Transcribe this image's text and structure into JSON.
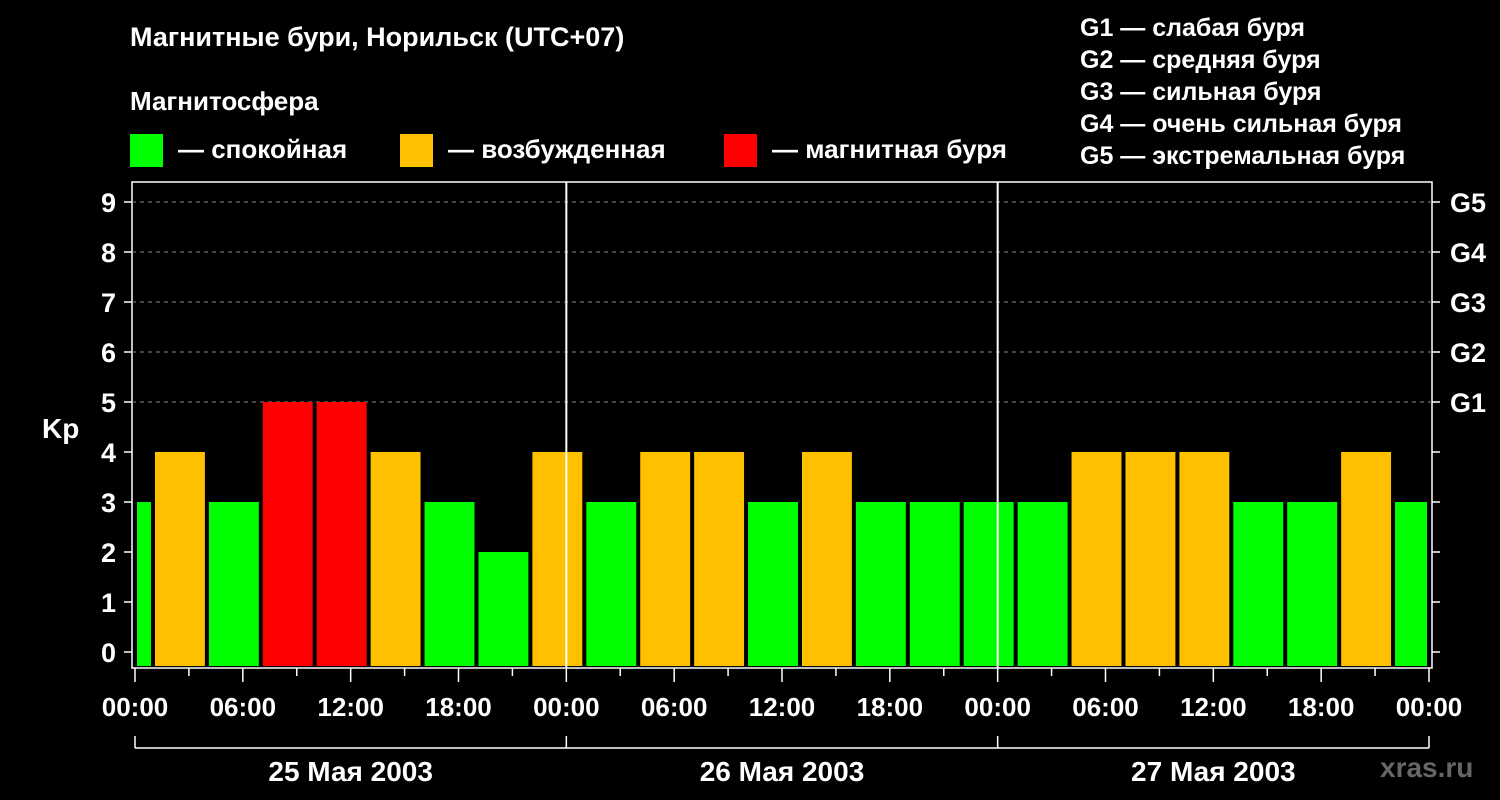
{
  "title": "Магнитные бури, Норильск (UTC+07)",
  "legend": {
    "title": "Магнитосфера",
    "items": [
      {
        "label": "— спокойная",
        "color": "#00ff00"
      },
      {
        "label": "— возбужденная",
        "color": "#ffc000"
      },
      {
        "label": "— магнитная буря",
        "color": "#ff0000"
      }
    ]
  },
  "g_scale": [
    "G1 — слабая буря",
    "G2 — средняя буря",
    "G3 — сильная буря",
    "G4 — очень сильная буря",
    "G5 — экстремальная буря"
  ],
  "watermark": "xras.ru",
  "chart_data": {
    "type": "bar",
    "ylabel": "Kp",
    "ylim": [
      0,
      9
    ],
    "yticks": [
      "0",
      "1",
      "2",
      "3",
      "4",
      "5",
      "6",
      "7",
      "8",
      "9"
    ],
    "right_ticks": [
      {
        "value": 5,
        "label": "G1"
      },
      {
        "value": 6,
        "label": "G2"
      },
      {
        "value": 7,
        "label": "G3"
      },
      {
        "value": 8,
        "label": "G4"
      },
      {
        "value": 9,
        "label": "G5"
      }
    ],
    "xticks": [
      "00:00",
      "06:00",
      "12:00",
      "18:00",
      "00:00",
      "06:00",
      "12:00",
      "18:00",
      "00:00",
      "06:00",
      "12:00",
      "18:00",
      "00:00"
    ],
    "days": [
      "25 Мая 2003",
      "26 Мая 2003",
      "27 Мая 2003"
    ],
    "grid": "dashed at Kp 5–9",
    "colors": {
      "quiet": "#00ff00",
      "active": "#ffc000",
      "storm": "#ff0000"
    },
    "bars": [
      {
        "start_hour": 0,
        "end_hour": 1,
        "value": 3,
        "level": "quiet"
      },
      {
        "start_hour": 1,
        "end_hour": 4,
        "value": 4,
        "level": "active"
      },
      {
        "start_hour": 4,
        "end_hour": 7,
        "value": 3,
        "level": "quiet"
      },
      {
        "start_hour": 7,
        "end_hour": 10,
        "value": 5,
        "level": "storm"
      },
      {
        "start_hour": 10,
        "end_hour": 13,
        "value": 5,
        "level": "storm"
      },
      {
        "start_hour": 13,
        "end_hour": 16,
        "value": 4,
        "level": "active"
      },
      {
        "start_hour": 16,
        "end_hour": 19,
        "value": 3,
        "level": "quiet"
      },
      {
        "start_hour": 19,
        "end_hour": 22,
        "value": 2,
        "level": "quiet"
      },
      {
        "start_hour": 22,
        "end_hour": 25,
        "value": 4,
        "level": "active"
      },
      {
        "start_hour": 25,
        "end_hour": 28,
        "value": 3,
        "level": "quiet"
      },
      {
        "start_hour": 28,
        "end_hour": 31,
        "value": 4,
        "level": "active"
      },
      {
        "start_hour": 31,
        "end_hour": 34,
        "value": 4,
        "level": "active"
      },
      {
        "start_hour": 34,
        "end_hour": 37,
        "value": 3,
        "level": "quiet"
      },
      {
        "start_hour": 37,
        "end_hour": 40,
        "value": 4,
        "level": "active"
      },
      {
        "start_hour": 40,
        "end_hour": 43,
        "value": 3,
        "level": "quiet"
      },
      {
        "start_hour": 43,
        "end_hour": 46,
        "value": 3,
        "level": "quiet"
      },
      {
        "start_hour": 46,
        "end_hour": 49,
        "value": 3,
        "level": "quiet"
      },
      {
        "start_hour": 49,
        "end_hour": 52,
        "value": 3,
        "level": "quiet"
      },
      {
        "start_hour": 52,
        "end_hour": 55,
        "value": 4,
        "level": "active"
      },
      {
        "start_hour": 55,
        "end_hour": 58,
        "value": 4,
        "level": "active"
      },
      {
        "start_hour": 58,
        "end_hour": 61,
        "value": 4,
        "level": "active"
      },
      {
        "start_hour": 61,
        "end_hour": 64,
        "value": 3,
        "level": "quiet"
      },
      {
        "start_hour": 64,
        "end_hour": 67,
        "value": 3,
        "level": "quiet"
      },
      {
        "start_hour": 67,
        "end_hour": 70,
        "value": 4,
        "level": "active"
      },
      {
        "start_hour": 70,
        "end_hour": 72,
        "value": 3,
        "level": "quiet"
      }
    ]
  }
}
